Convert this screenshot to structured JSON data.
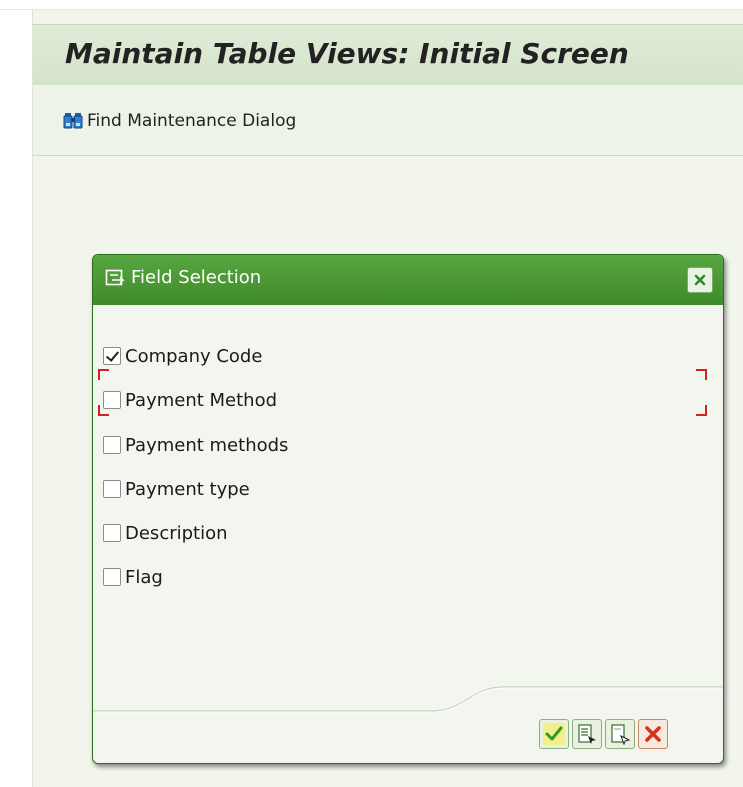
{
  "header": {
    "title": "Maintain Table Views: Initial Screen"
  },
  "toolbar": {
    "find_label": "Find Maintenance Dialog",
    "find_icon": "binoculars-icon"
  },
  "dialog": {
    "title": "Field Selection",
    "title_icon": "field-selection-icon",
    "close_icon": "close-icon",
    "fields": [
      {
        "label": "Company Code",
        "checked": true
      },
      {
        "label": "Payment Method",
        "checked": false
      },
      {
        "label": "Payment methods",
        "checked": false
      },
      {
        "label": "Payment type",
        "checked": false
      },
      {
        "label": "Description",
        "checked": false
      },
      {
        "label": "Flag",
        "checked": false
      }
    ],
    "buttons": [
      {
        "name": "continue-button",
        "icon": "checkmark-icon"
      },
      {
        "name": "select-all-button",
        "icon": "select-all-icon"
      },
      {
        "name": "deselect-all-button",
        "icon": "deselect-all-icon"
      },
      {
        "name": "cancel-button",
        "icon": "cancel-icon"
      }
    ]
  },
  "colors": {
    "dialog_header": "#4a9a33",
    "title_bar": "#d8e7ce",
    "focus_marker": "#d62020"
  }
}
